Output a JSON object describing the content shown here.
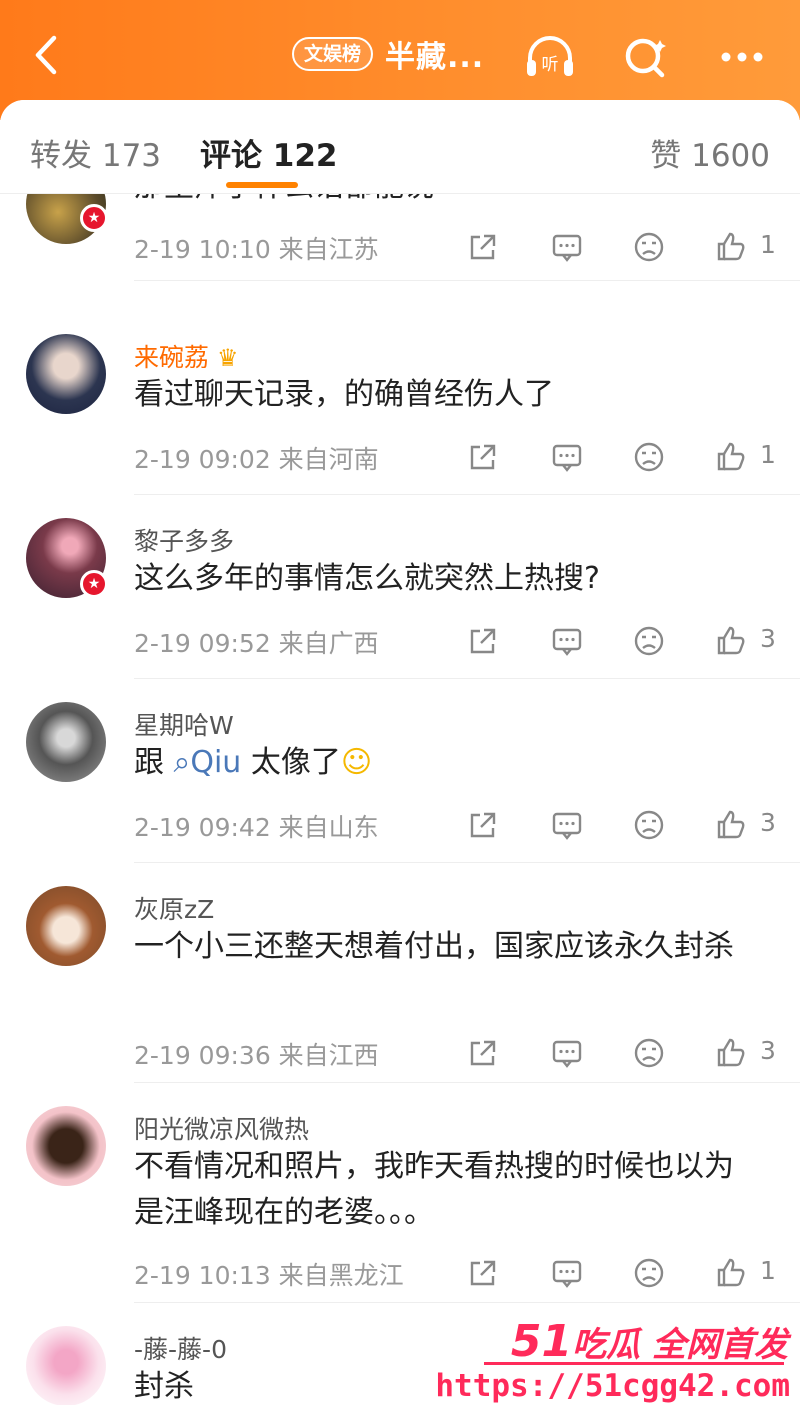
{
  "header": {
    "tag": "文娱榜",
    "title": "半藏...",
    "icons": [
      "back-icon",
      "listen-icon",
      "search-icon",
      "more-icon"
    ],
    "listen_label": "听"
  },
  "tabs": {
    "repost": "转发 173",
    "comments": "评论 122",
    "likes": "赞 1600"
  },
  "comments": [
    {
      "name": "",
      "text": "那里痒了什么话都能说",
      "meta": "2-19 10:10  来自江苏",
      "likes": "1"
    },
    {
      "name": "来碗荔",
      "text": "看过聊天记录，的确曾经伤人了",
      "meta": "2-19 09:02  来自河南",
      "likes": "1"
    },
    {
      "name": "黎子多多",
      "text": "这么多年的事情怎么就突然上热搜?",
      "meta": "2-19 09:52  来自广西",
      "likes": "3"
    },
    {
      "name": "星期哈W",
      "text_pre": "跟 ",
      "mention": "Qiu",
      "text_post": " 太像了",
      "meta": "2-19 09:42  来自山东",
      "likes": "3"
    },
    {
      "name": "灰原zZ",
      "text": "一个小三还整天想着付出，国家应该永久封杀",
      "meta": "2-19 09:36  来自江西",
      "likes": "3"
    },
    {
      "name": "阳光微凉风微热",
      "text": "不看情况和照片，我昨天看热搜的时候也以为是汪峰现在的老婆。。。",
      "meta": "2-19 10:13  来自黑龙江",
      "likes": "1"
    },
    {
      "name": "-藤-藤-0",
      "text": "封杀",
      "meta": "",
      "likes": ""
    }
  ],
  "watermark": {
    "num": "51",
    "slogan": "吃瓜 全网首发",
    "url": "https://51cgg42.com"
  },
  "colors": {
    "accent": "#ff8200",
    "header": "#ff7a1a",
    "watermark": "#ff2a5a"
  }
}
